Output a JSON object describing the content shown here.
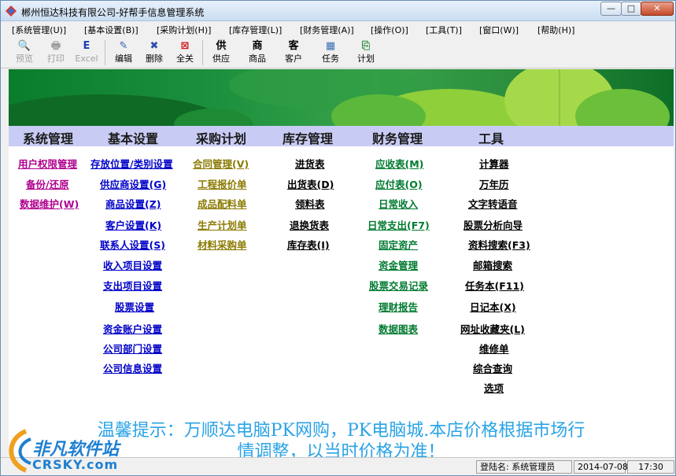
{
  "window": {
    "title": "郴州恒达科技有限公司-好帮手信息管理系统",
    "buttons": {
      "minimize": "—",
      "maximize": "□",
      "close": "✕"
    }
  },
  "menu": [
    "[系统管理(U)]",
    "[基本设置(B)]",
    "[采购计划(H)]",
    "[库存管理(L)]",
    "[财务管理(A)]",
    "[操作(O)]",
    "[工具(T)]",
    "[窗口(W)]",
    "[帮助(H)]"
  ],
  "toolbar": [
    {
      "label": "预览",
      "icon": "preview-icon",
      "glyph": "🔍",
      "disabled": true
    },
    {
      "label": "打印",
      "icon": "print-icon",
      "glyph": "🖶",
      "disabled": true
    },
    {
      "label": "Excel",
      "icon": "excel-icon",
      "glyph": "E",
      "disabled": true
    },
    {
      "label": "编辑",
      "icon": "edit-icon",
      "glyph": "✎",
      "disabled": false
    },
    {
      "label": "删除",
      "icon": "delete-icon",
      "glyph": "✖",
      "disabled": false
    },
    {
      "label": "全关",
      "icon": "close-all-icon",
      "glyph": "⊠",
      "disabled": false
    },
    {
      "label": "供应",
      "icon": "supply-icon",
      "glyph": "供",
      "disabled": false
    },
    {
      "label": "商品",
      "icon": "goods-icon",
      "glyph": "商",
      "disabled": false
    },
    {
      "label": "客户",
      "icon": "customer-icon",
      "glyph": "客",
      "disabled": false
    },
    {
      "label": "任务",
      "icon": "task-icon",
      "glyph": "▦",
      "disabled": false
    },
    {
      "label": "计划",
      "icon": "plan-icon",
      "glyph": "⎘",
      "disabled": false
    }
  ],
  "categories": [
    "系统管理",
    "基本设置",
    "采购计划",
    "库存管理",
    "财务管理",
    "工具"
  ],
  "columns": [
    {
      "color": "purple",
      "items": [
        "用户权限管理",
        "备份/还原",
        "数据维护(W)"
      ]
    },
    {
      "color": "blue",
      "items": [
        "存放位置/类别设置",
        "供应商设置(G)",
        "商品设置(Z)",
        "客户设置(K)",
        "联系人设置(S)",
        "收入项目设置",
        "支出项目设置",
        "股票设置",
        "资金账户设置",
        "公司部门设置",
        "公司信息设置"
      ]
    },
    {
      "color": "olive",
      "items": [
        "合同管理(V)",
        "工程报价单",
        "成品配料单",
        "生产计划单",
        "材料采购单"
      ]
    },
    {
      "color": "black",
      "items": [
        "进货表",
        "出货表(D)",
        "领料表",
        "退换货表",
        "库存表(I)"
      ]
    },
    {
      "color": "green",
      "items": [
        "应收表(M)",
        "应付表(O)",
        "日常收入",
        "日常支出(F7)",
        "固定资产",
        "资金管理",
        "股票交易记录",
        "理财报告",
        "数据图表"
      ]
    },
    {
      "color": "black",
      "items": [
        "计算器",
        "万年历",
        "文字转语音",
        "股票分析向导",
        "资料搜索(F3)",
        "邮箱搜索",
        "任务本(F11)",
        "日记本(X)",
        "网址收藏夹(L)",
        "维修单",
        "综合查询",
        "选项"
      ]
    }
  ],
  "notice": {
    "line1": "温馨提示：万顺达电脑PK网购，PK电脑城.本店价格根据市场行",
    "line2": "情调整，以当时价格为准！"
  },
  "status": {
    "user": "登陆名: 系统管理员",
    "date": "2014-07-08",
    "time": "17:30"
  },
  "watermark": {
    "line1": "非凡软件站",
    "line2": "CRSKY.com"
  }
}
